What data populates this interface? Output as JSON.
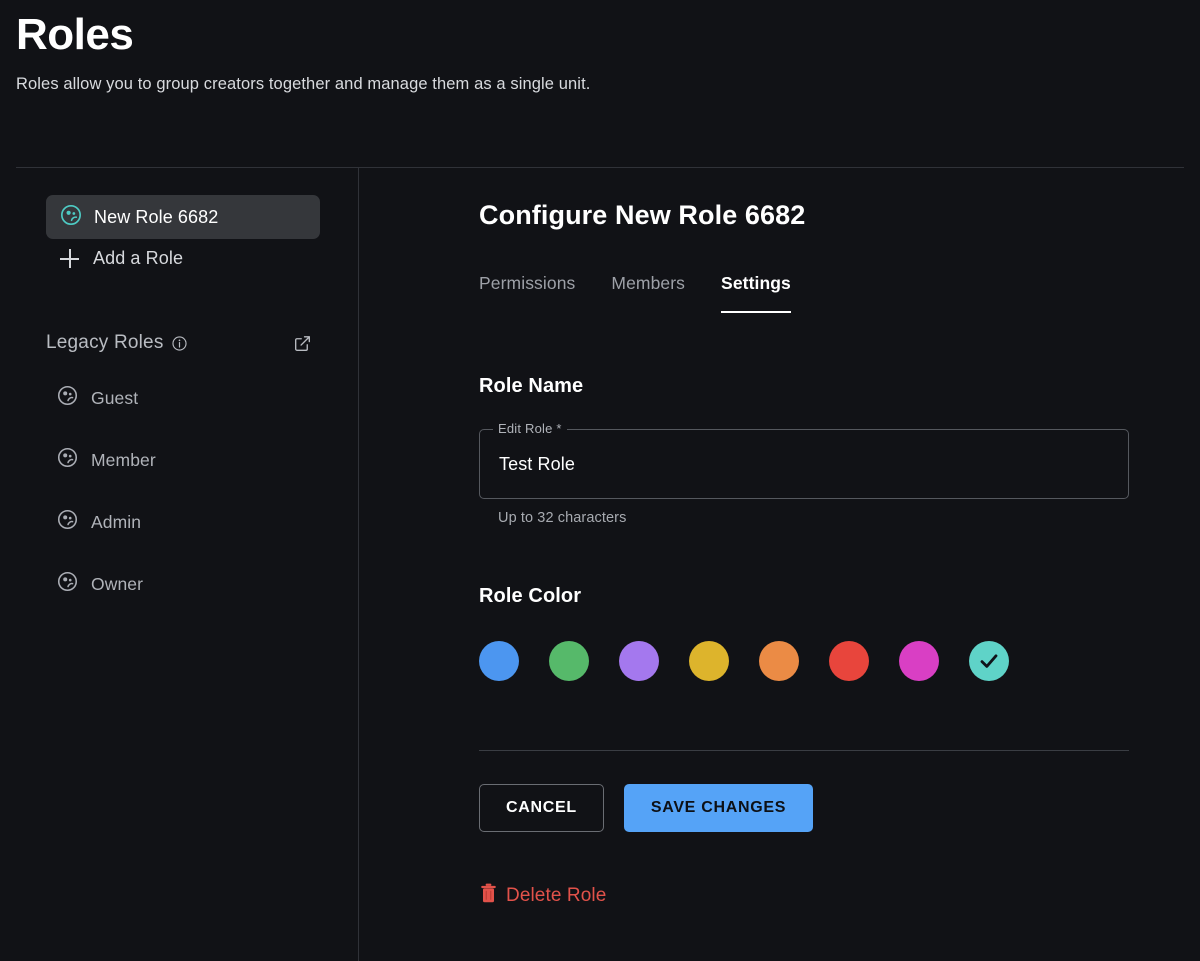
{
  "page": {
    "title": "Roles",
    "subtitle": "Roles allow you to group creators together and manage them as a single unit."
  },
  "sidebar": {
    "current_role": {
      "label": "New Role 6682",
      "icon": "group-role-icon",
      "icon_color": "#4ecbc4",
      "selected": true
    },
    "add_role": {
      "label": "Add a Role",
      "icon": "plus-icon"
    },
    "legacy": {
      "title": "Legacy Roles",
      "info_icon": "info-circle-icon",
      "external_link_icon": "external-link-icon",
      "items": [
        {
          "label": "Guest",
          "icon": "group-role-icon"
        },
        {
          "label": "Member",
          "icon": "group-role-icon"
        },
        {
          "label": "Admin",
          "icon": "group-role-icon"
        },
        {
          "label": "Owner",
          "icon": "group-role-icon"
        }
      ]
    }
  },
  "main": {
    "title": "Configure New Role 6682",
    "tabs": [
      {
        "label": "Permissions",
        "active": false
      },
      {
        "label": "Members",
        "active": false
      },
      {
        "label": "Settings",
        "active": true
      }
    ],
    "role_name": {
      "section_title": "Role Name",
      "field_label": "Edit Role *",
      "value": "Test Role",
      "placeholder": "",
      "helper": "Up to 32 characters"
    },
    "role_color": {
      "section_title": "Role Color",
      "selected_index": 7,
      "swatches": [
        {
          "name": "blue",
          "hex": "#4c96f0"
        },
        {
          "name": "green",
          "hex": "#56b96a"
        },
        {
          "name": "purple",
          "hex": "#a478ee"
        },
        {
          "name": "yellow",
          "hex": "#ddb42c"
        },
        {
          "name": "orange",
          "hex": "#eb8b45"
        },
        {
          "name": "red",
          "hex": "#e8453c"
        },
        {
          "name": "pink",
          "hex": "#d93fc4"
        },
        {
          "name": "teal",
          "hex": "#5fd3c8"
        }
      ]
    },
    "actions": {
      "cancel_label": "CANCEL",
      "save_label": "SAVE CHANGES",
      "save_color": "#55a3f7"
    },
    "delete": {
      "label": "Delete Role",
      "icon": "trash-icon",
      "color": "#e2524a"
    }
  }
}
